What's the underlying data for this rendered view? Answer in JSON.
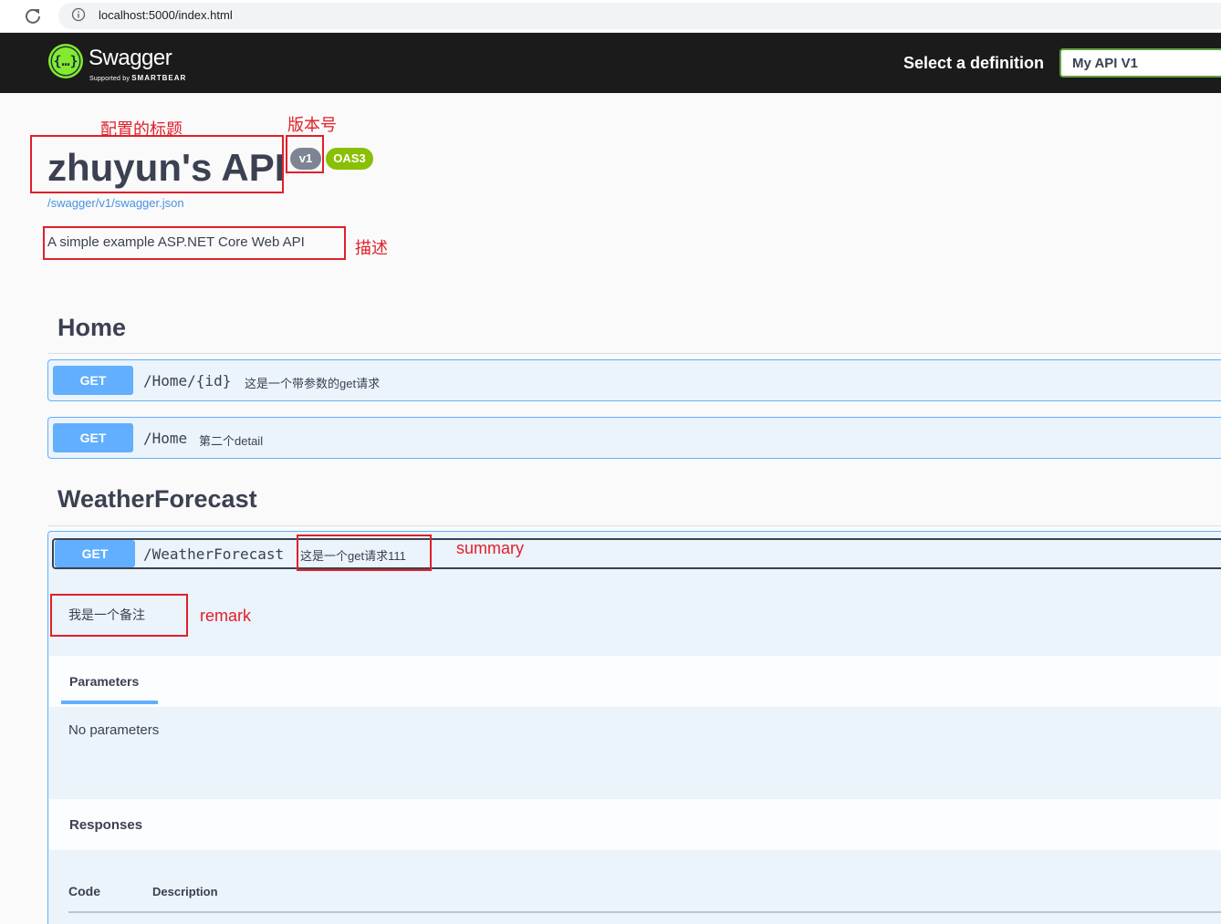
{
  "browser": {
    "url": "localhost:5000/index.html"
  },
  "topbar": {
    "logo_name": "Swagger",
    "logo_sub_prefix": "Supported by",
    "logo_sub_brand": "SMARTBEAR",
    "select_label": "Select a definition",
    "select_value": "My API V1"
  },
  "info": {
    "title": "zhuyun's API",
    "version": "v1",
    "oas": "OAS3",
    "json_link": "/swagger/v1/swagger.json",
    "description": "A simple example ASP.NET Core Web API"
  },
  "annotations": {
    "title_note": "配置的标题",
    "version_note": "版本号",
    "desc_note": "描述",
    "summary_note": "summary",
    "remark_note": "remark"
  },
  "tags": [
    {
      "name": "Home",
      "operations": [
        {
          "method": "GET",
          "path": "/Home/{id}",
          "summary": "这是一个带参数的get请求"
        },
        {
          "method": "GET",
          "path": "/Home",
          "summary": "第二个detail"
        }
      ]
    },
    {
      "name": "WeatherForecast",
      "operations": [
        {
          "method": "GET",
          "path": "/WeatherForecast",
          "summary": "这是一个get请求111",
          "remark": "我是一个备注",
          "parameters_title": "Parameters",
          "no_parameters": "No parameters",
          "responses_title": "Responses",
          "col_code": "Code",
          "col_description": "Description"
        }
      ]
    }
  ],
  "colors": {
    "get": "#61affe",
    "get_bg": "#ebf3fb",
    "topbar": "#1b1b1b",
    "oas_badge": "#89bf04",
    "version_badge": "#7d8492",
    "annotation": "#e0202a"
  }
}
